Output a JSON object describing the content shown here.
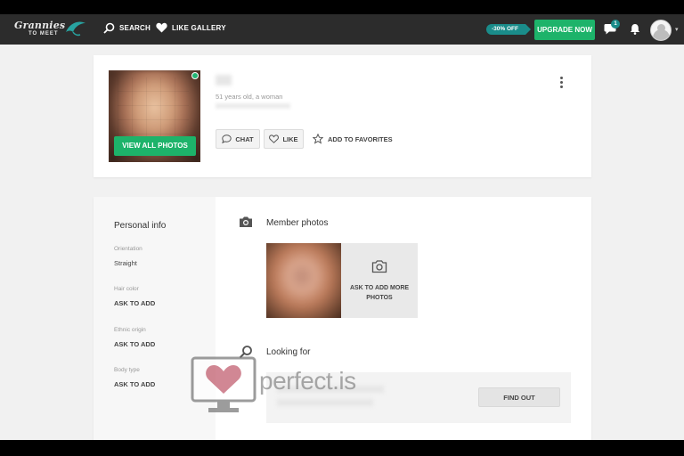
{
  "nav": {
    "logo_line1": "Grannies",
    "logo_line2": "TO MEET",
    "search_label": "SEARCH",
    "like_gallery_label": "LIKE GALLERY",
    "discount_badge": "-30% OFF",
    "upgrade_label": "UPGRADE NOW",
    "message_count": "1",
    "accent_color": "#1db36a",
    "teal_color": "#1a8c8a"
  },
  "profile": {
    "subtitle": "51 years old, a woman",
    "view_all_label": "VIEW ALL PHOTOS",
    "chat_label": "CHAT",
    "like_label": "LIKE",
    "favorites_label": "ADD TO FAVORITES",
    "online": true
  },
  "personal_info": {
    "title": "Personal info",
    "fields": [
      {
        "label": "Orientation",
        "value": "Straight"
      },
      {
        "label": "Hair color",
        "value": "ASK TO ADD"
      },
      {
        "label": "Ethnic origin",
        "value": "ASK TO ADD"
      },
      {
        "label": "Body type",
        "value": "ASK TO ADD"
      }
    ]
  },
  "member_photos": {
    "title": "Member photos",
    "ask_more_label": "ASK TO ADD MORE PHOTOS"
  },
  "looking_for": {
    "title": "Looking for",
    "find_out_label": "FIND OUT"
  },
  "watermark": {
    "text": "perfect.is"
  }
}
